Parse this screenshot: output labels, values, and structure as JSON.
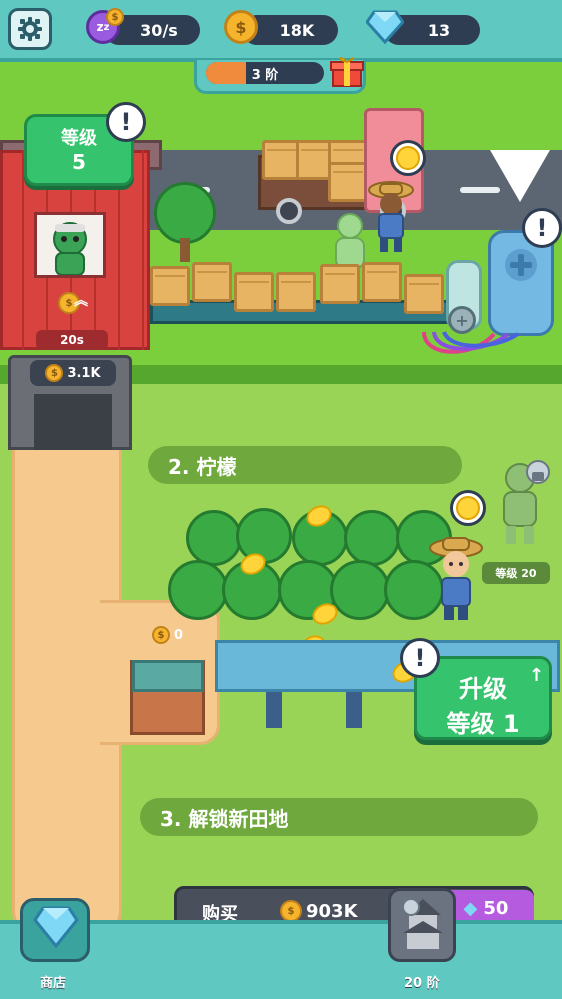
{
  "hud": {
    "production_rate": "30/s",
    "coins": "18K",
    "gems": "13",
    "stage_label": "3 阶",
    "stage_progress": 0.34
  },
  "barn": {
    "level_title": "等级",
    "level_value": "5",
    "timer": "20s",
    "unlock_cost": "3.1K"
  },
  "fields": {
    "lemon_label": "2. 柠檬",
    "lemon_stock": "0",
    "locked_worker_level": "等级 20",
    "new_field_label": "3. 解锁新田地"
  },
  "upgrade": {
    "title": "升级",
    "level": "等级 1"
  },
  "buy_bar": {
    "buy_label": "购买",
    "coin_cost": "903K",
    "gem_cost": "50"
  },
  "nav": {
    "shop_label": "商店",
    "stage_label": "20 阶"
  },
  "colors": {
    "hud_bg": "#5fc8c0",
    "green_button": "#35c46d",
    "barn_red": "#d9433f",
    "coin": "#f6b42c"
  }
}
